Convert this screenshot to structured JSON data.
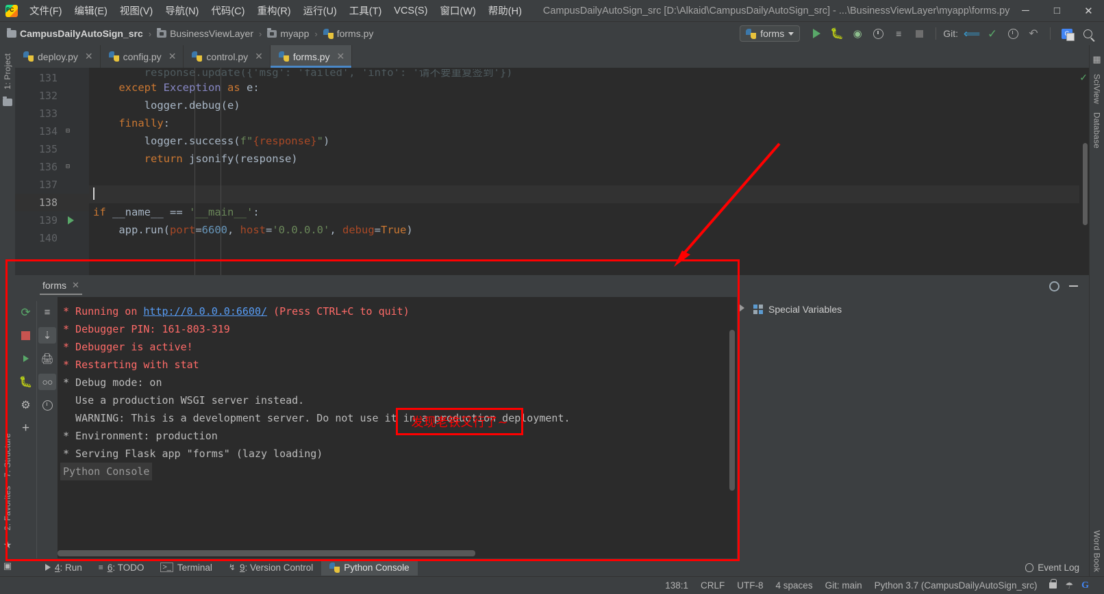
{
  "window": {
    "title": "CampusDailyAutoSign_src [D:\\Alkaid\\CampusDailyAutoSign_src] - ...\\BusinessViewLayer\\myapp\\forms.py",
    "logo": "pycharm-logo",
    "minimize": "─",
    "maximize": "□",
    "close": "✕"
  },
  "menubar": {
    "items": [
      {
        "label": "文件(F)"
      },
      {
        "label": "编辑(E)"
      },
      {
        "label": "视图(V)"
      },
      {
        "label": "导航(N)"
      },
      {
        "label": "代码(C)"
      },
      {
        "label": "重构(R)"
      },
      {
        "label": "运行(U)"
      },
      {
        "label": "工具(T)"
      },
      {
        "label": "VCS(S)"
      },
      {
        "label": "窗口(W)"
      },
      {
        "label": "帮助(H)"
      }
    ]
  },
  "breadcrumb": {
    "items": [
      {
        "label": "CampusDailyAutoSign_src",
        "icon": "folder-icon",
        "bold": true
      },
      {
        "label": "BusinessViewLayer",
        "icon": "folder-icon",
        "bold": false
      },
      {
        "label": "myapp",
        "icon": "folder-icon",
        "bold": false
      },
      {
        "label": "forms.py",
        "icon": "python-file-icon",
        "bold": false
      }
    ],
    "separator": "›"
  },
  "toolbar": {
    "run_config": "forms",
    "run_config_icon": "python-icon",
    "buttons": [
      {
        "name": "run-button",
        "icon": "play-icon"
      },
      {
        "name": "debug-button",
        "icon": "bug-icon"
      },
      {
        "name": "run-with-coverage-button",
        "icon": "coverage-icon"
      },
      {
        "name": "profile-button",
        "icon": "profiler-icon"
      },
      {
        "name": "run-anything-button",
        "icon": "run-list-icon"
      },
      {
        "name": "stop-button",
        "icon": "stop-icon"
      }
    ],
    "git_label": "Git:",
    "git_buttons": [
      {
        "name": "update-project-button",
        "icon": "arrow-down-left-icon"
      },
      {
        "name": "commit-button",
        "icon": "checkmark-icon"
      },
      {
        "name": "history-button",
        "icon": "clock-icon"
      },
      {
        "name": "rollback-button",
        "icon": "undo-icon"
      }
    ],
    "translate_icon": "google-translate-icon",
    "search_icon": "search-icon"
  },
  "editor_tabs": [
    {
      "label": "deploy.py",
      "active": false
    },
    {
      "label": "config.py",
      "active": false
    },
    {
      "label": "control.py",
      "active": false
    },
    {
      "label": "forms.py",
      "active": true
    }
  ],
  "left_strip": {
    "project_label": "1: Project",
    "structure_label": "7: Structure",
    "favorites_label": "2: Favorites"
  },
  "right_strip": {
    "sciview_label": "SciView",
    "database_label": "Database",
    "wordbook_label": "Word Book"
  },
  "code": {
    "lines": [
      {
        "num": "131",
        "cut": true,
        "tokens": [
          {
            "t": "        response.update({",
            "c": "ghost"
          },
          {
            "t": "'msg'",
            "c": "ghost"
          },
          {
            "t": ": ",
            "c": "ghost"
          },
          {
            "t": "'failed'",
            "c": "ghost"
          },
          {
            "t": ", ",
            "c": "ghost"
          },
          {
            "t": "'info'",
            "c": "ghost"
          },
          {
            "t": ": ",
            "c": "ghost"
          },
          {
            "t": "'请不要重复签到'",
            "c": "ghost"
          },
          {
            "t": "})",
            "c": "ghost"
          }
        ]
      },
      {
        "num": "132",
        "tokens": [
          {
            "t": "    ",
            "c": "plain"
          },
          {
            "t": "except ",
            "c": "k"
          },
          {
            "t": "Exception ",
            "c": "builtin"
          },
          {
            "t": "as",
            "c": "k"
          },
          {
            "t": " e:",
            "c": "plain"
          }
        ]
      },
      {
        "num": "133",
        "tokens": [
          {
            "t": "        logger.debug(e)",
            "c": "plain"
          }
        ]
      },
      {
        "num": "134",
        "fold": true,
        "tokens": [
          {
            "t": "    ",
            "c": "plain"
          },
          {
            "t": "finally",
            "c": "k"
          },
          {
            "t": ":",
            "c": "plain"
          }
        ]
      },
      {
        "num": "135",
        "tokens": [
          {
            "t": "        logger.success(",
            "c": "plain"
          },
          {
            "t": "f\"",
            "c": "str"
          },
          {
            "t": "{response}",
            "c": "kwarg"
          },
          {
            "t": "\"",
            "c": "str"
          },
          {
            "t": ")",
            "c": "plain"
          }
        ]
      },
      {
        "num": "136",
        "fold": true,
        "tokens": [
          {
            "t": "        ",
            "c": "plain"
          },
          {
            "t": "return",
            "c": "k"
          },
          {
            "t": " jsonify(response)",
            "c": "plain"
          }
        ]
      },
      {
        "num": "137",
        "tokens": []
      },
      {
        "num": "138",
        "current": true,
        "caret": true,
        "tokens": []
      },
      {
        "num": "139",
        "runmarker": true,
        "tokens": [
          {
            "t": "if",
            "c": "k"
          },
          {
            "t": " __name__ ",
            "c": "plain"
          },
          {
            "t": "==",
            "c": "plain"
          },
          {
            "t": " ",
            "c": "plain"
          },
          {
            "t": "'__main__'",
            "c": "str"
          },
          {
            "t": ":",
            "c": "plain"
          }
        ]
      },
      {
        "num": "140",
        "tokens": [
          {
            "t": "    app.run(",
            "c": "plain"
          },
          {
            "t": "port",
            "c": "kwarg"
          },
          {
            "t": "=",
            "c": "plain"
          },
          {
            "t": "6600",
            "c": "num"
          },
          {
            "t": ", ",
            "c": "plain"
          },
          {
            "t": "host",
            "c": "kwarg"
          },
          {
            "t": "=",
            "c": "plain"
          },
          {
            "t": "'0.0.0.0'",
            "c": "str"
          },
          {
            "t": ", ",
            "c": "plain"
          },
          {
            "t": "debug",
            "c": "kwarg"
          },
          {
            "t": "=",
            "c": "plain"
          },
          {
            "t": "True",
            "c": "k"
          },
          {
            "t": ")",
            "c": "plain"
          }
        ]
      }
    ]
  },
  "console_panel": {
    "tab_label": "forms",
    "tab_close": "✕",
    "settings_icon": "gear-icon",
    "hide_icon": "minimize-icon",
    "toolbar_left": [
      {
        "name": "rerun-button",
        "icon": "rerun-icon"
      },
      {
        "name": "stop-button",
        "icon": "stop-icon"
      },
      {
        "name": "execute-button",
        "icon": "play-icon"
      },
      {
        "name": "attach-debugger-button",
        "icon": "bug-icon"
      },
      {
        "name": "settings-button",
        "icon": "gear-icon"
      },
      {
        "name": "new-console-button",
        "icon": "plus-icon"
      }
    ],
    "toolbar_right": [
      {
        "name": "soft-wrap-button",
        "icon": "wrap-icon"
      },
      {
        "name": "scroll-to-end-button",
        "icon": "scroll-end-icon",
        "selected": true
      },
      {
        "name": "print-button",
        "icon": "printer-icon"
      },
      {
        "name": "show-variables-button",
        "icon": "glasses-icon",
        "selected": true
      },
      {
        "name": "history-button",
        "icon": "clock-icon"
      }
    ],
    "output": [
      {
        "text": "Python Console",
        "style": "header"
      },
      {
        "text": "* Serving Flask app \"forms\" (lazy loading)",
        "style": "white"
      },
      {
        "text": "* Environment: production",
        "style": "white"
      },
      {
        "text": "  WARNING: This is a development server. Do not use it in a production deployment.",
        "style": "white"
      },
      {
        "text": "  Use a production WSGI server instead.",
        "style": "white"
      },
      {
        "text": "* Debug mode: on",
        "style": "white"
      },
      {
        "text": "* Restarting with stat",
        "style": "red"
      },
      {
        "text": "* Debugger is active!",
        "style": "red"
      },
      {
        "text": "* Debugger PIN: 161-803-319",
        "style": "red"
      },
      {
        "text": "* Running on ",
        "style": "red",
        "link": "http://0.0.0.0:6600/",
        "suffix": " (Press CTRL+C to quit)"
      }
    ],
    "variables": {
      "label": "Special Variables",
      "icon": "variables-icon",
      "expander": "▶"
    }
  },
  "annotations": {
    "note_text": "发现老铁又行了~",
    "color": "#ff0000"
  },
  "tool_window_tabs": [
    {
      "num": "4",
      "label": ": Run",
      "icon": "play-icon",
      "active": false
    },
    {
      "num": "6",
      "label": ": TODO",
      "icon": "todo-icon",
      "active": false
    },
    {
      "num": "",
      "label": "Terminal",
      "icon": "terminal-icon",
      "active": false
    },
    {
      "num": "9",
      "label": ": Version Control",
      "icon": "vcs-icon",
      "active": false
    },
    {
      "num": "",
      "label": "Python Console",
      "icon": "python-icon",
      "active": true
    }
  ],
  "event_log": {
    "label": "Event Log",
    "icon": "bell-icon"
  },
  "statusbar": {
    "caret": "138:1",
    "line_sep": "CRLF",
    "encoding": "UTF-8",
    "indent": "4 spaces",
    "branch": "Git: main",
    "interpreter": "Python 3.7 (CampusDailyAutoSign_src)",
    "icons": [
      {
        "name": "lock-icon"
      },
      {
        "name": "inspector-icon"
      },
      {
        "name": "google-icon"
      }
    ]
  }
}
